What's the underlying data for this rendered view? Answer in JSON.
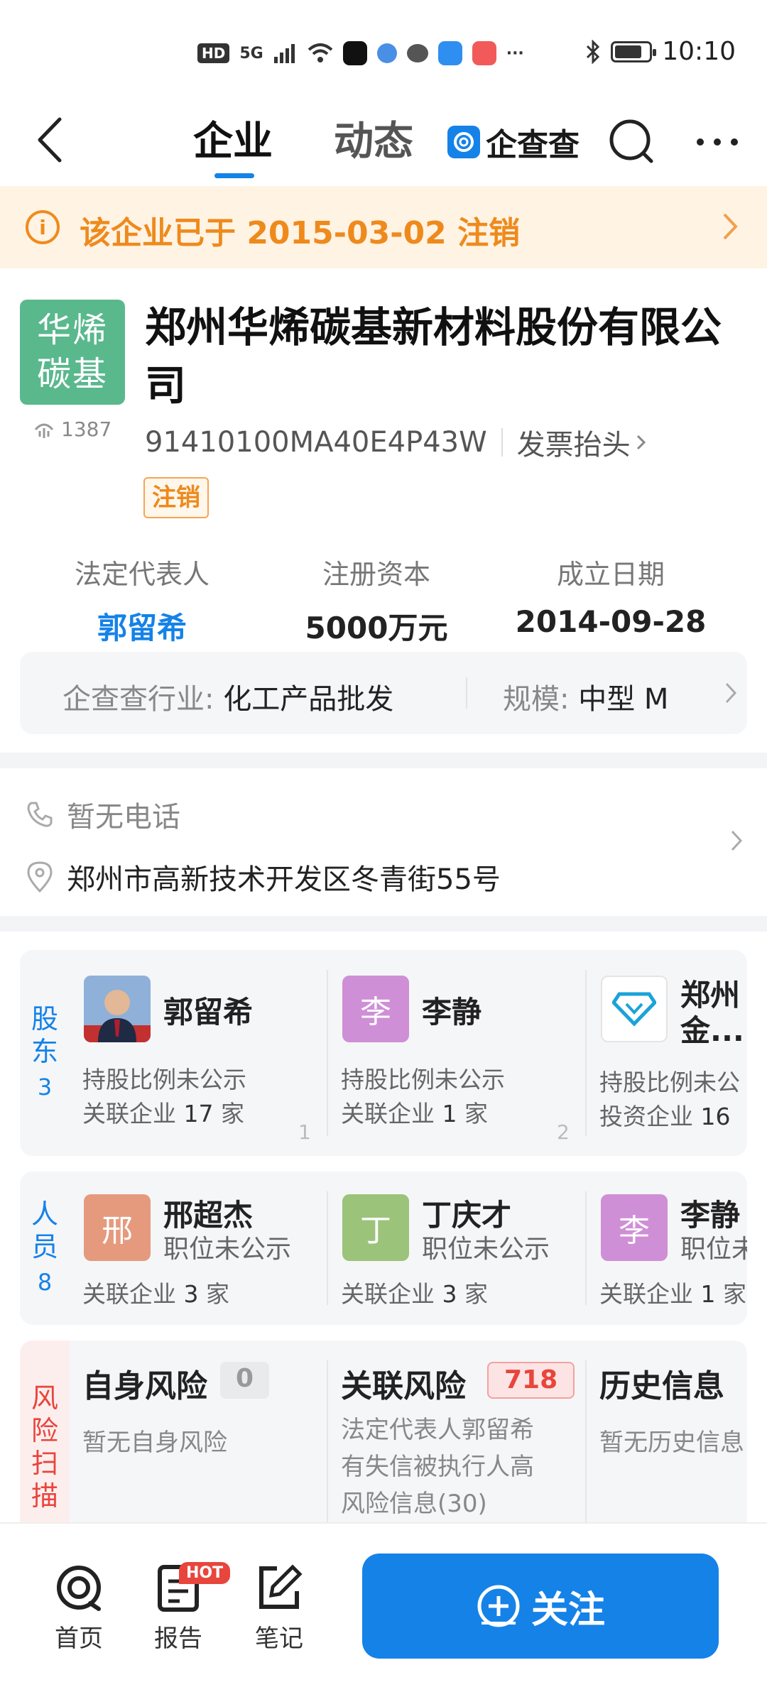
{
  "status_bar": {
    "hd_badge": "HD",
    "signal_label": "5G",
    "more": "···",
    "time": "10:10",
    "battery_level": 0.8
  },
  "header": {
    "tabs": [
      {
        "label": "企业",
        "active": true
      },
      {
        "label": "动态",
        "active": false
      }
    ],
    "brand_name": "企查查"
  },
  "notice": {
    "text": "该企业已于 2015-03-02 注销",
    "color": "#ee8a1c"
  },
  "company": {
    "logo_text_line1": "华烯",
    "logo_text_line2": "碳基",
    "logo_color": "#5ab88d",
    "views": "1387",
    "name": "郑州华烯碳基新材料股份有限公司",
    "credit_code": "91410100MA40E4P43W",
    "invoice_label": "发票抬头",
    "status_tag": "注销"
  },
  "key_info": [
    {
      "label": "法定代表人",
      "value": "郭留希",
      "link": true
    },
    {
      "label": "注册资本",
      "value": "5000万元",
      "link": false
    },
    {
      "label": "成立日期",
      "value": "2014-09-28",
      "link": false
    }
  ],
  "industry": {
    "industry_label": "企查查行业:",
    "industry_value": "化工产品批发",
    "scale_label": "规模:",
    "scale_value": "中型 M"
  },
  "contact": {
    "phone": "暂无电话",
    "address": "郑州市高新技术开发区冬青街55号"
  },
  "shareholders": {
    "side_line1": "股",
    "side_line2": "东",
    "count": "3",
    "items": [
      {
        "avatar": "",
        "name": "郭留希",
        "line1": "持股比例未公示",
        "line2_prefix": "关联企业 ",
        "line2_num": "17",
        "line2_suffix": " 家",
        "index": "1"
      },
      {
        "avatar": "李",
        "name": "李静",
        "line1": "持股比例未公示",
        "line2_prefix": "关联企业 ",
        "line2_num": "1",
        "line2_suffix": " 家",
        "index": "2"
      },
      {
        "avatar": "",
        "name": "郑州",
        "name2": "金...",
        "line1": "持股比例未公",
        "line2_prefix": "投资企业 ",
        "line2_num": "16",
        "line2_suffix": "",
        "index": ""
      }
    ]
  },
  "staff": {
    "side_line1": "人",
    "side_line2": "员",
    "count": "8",
    "items": [
      {
        "avatar": "邢",
        "color": "#e59a7e",
        "name": "邢超杰",
        "title": "职位未公示",
        "line2_prefix": "关联企业 ",
        "line2_num": "3",
        "line2_suffix": " 家"
      },
      {
        "avatar": "丁",
        "color": "#9cc37a",
        "name": "丁庆才",
        "title": "职位未公示",
        "line2_prefix": "关联企业 ",
        "line2_num": "3",
        "line2_suffix": " 家"
      },
      {
        "avatar": "李",
        "color": "#cf8fd6",
        "name": "李静",
        "title": "职位未",
        "line2_prefix": "关联企业 ",
        "line2_num": "1",
        "line2_suffix": " 家"
      }
    ]
  },
  "risk": {
    "side_chars": [
      "风",
      "险",
      "扫",
      "描"
    ],
    "items": [
      {
        "title": "自身风险",
        "count": "0",
        "text_lines": [
          "暂无自身风险"
        ]
      },
      {
        "title": "关联风险",
        "count": "718",
        "text_lines": [
          "法定代表人郭留希",
          "有失信被执行人高",
          "风险信息(30)"
        ]
      },
      {
        "title": "历史信息",
        "count": "",
        "text_lines": [
          "暂无历史信息"
        ]
      }
    ]
  },
  "bottom_nav": {
    "items": [
      {
        "label": "首页",
        "icon": "home-logo-icon"
      },
      {
        "label": "报告",
        "icon": "report-icon",
        "badge": "HOT"
      },
      {
        "label": "笔记",
        "icon": "note-icon"
      }
    ],
    "follow_label": "关注"
  },
  "colors": {
    "primary": "#1582e8",
    "warning": "#ee8a1c",
    "danger": "#e8453c"
  }
}
